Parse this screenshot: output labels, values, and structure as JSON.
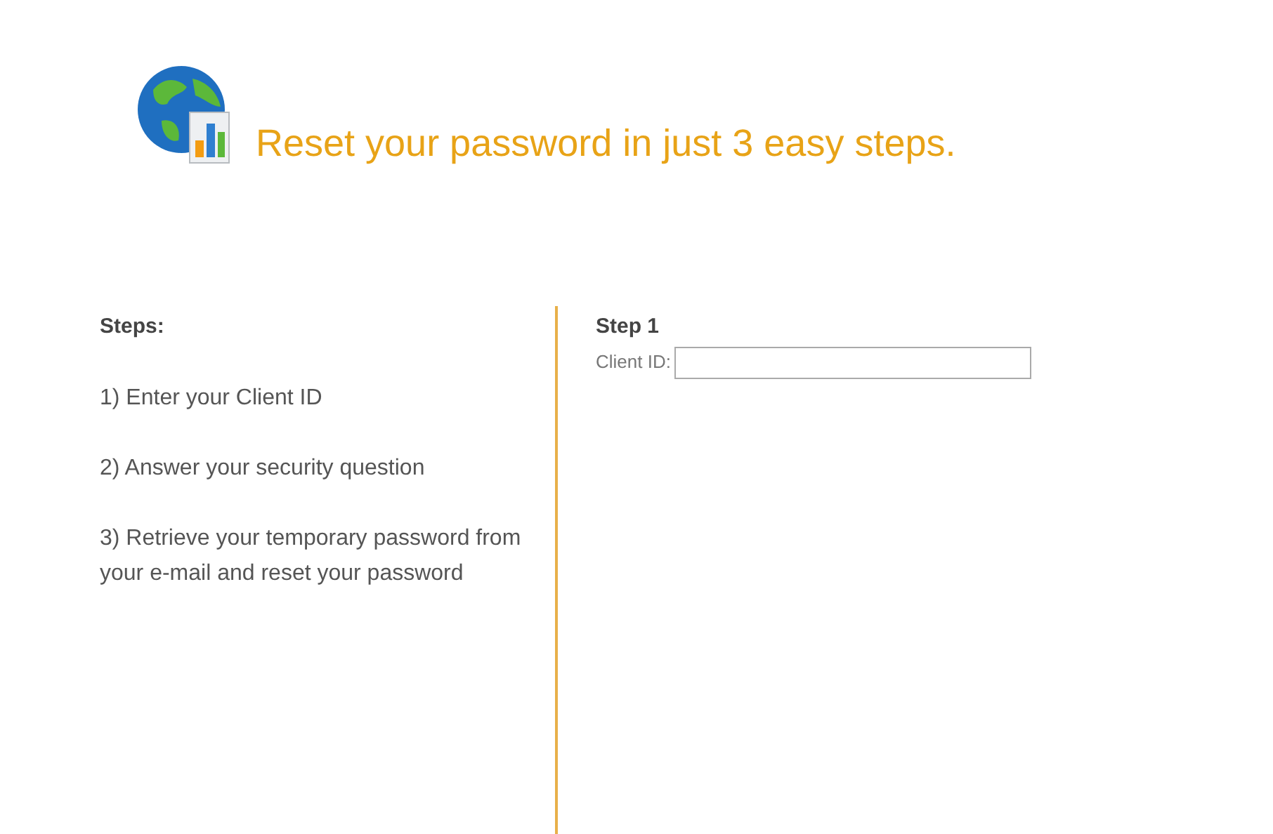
{
  "header": {
    "title": "Reset your password in just 3 easy steps."
  },
  "steps_panel": {
    "heading": "Steps:",
    "items": [
      "1) Enter your Client ID",
      "2) Answer your security question",
      "3) Retrieve your temporary password from your e-mail and reset your password"
    ]
  },
  "form": {
    "heading": "Step 1",
    "label": "Client ID:"
  }
}
